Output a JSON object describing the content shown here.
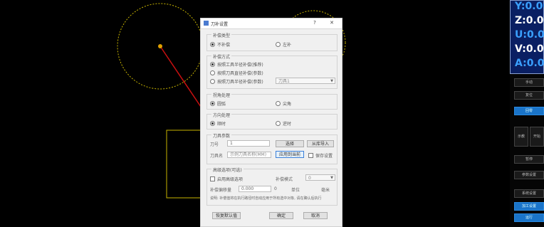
{
  "cad": {
    "circle_color": "#c8b400",
    "line_color": "#c81010",
    "center_color": "#e0a000",
    "rect_color": "#c8b400"
  },
  "dialog": {
    "title": "刀补设置",
    "icon": "app-icon",
    "help_label": "?",
    "close_label": "✕",
    "groups": {
      "g1": {
        "title": "补偿类型",
        "opt_a": "不补偿",
        "opt_b": "左补"
      },
      "g2": {
        "title": "补偿方式",
        "opt_a": "按照工具半径补偿(推荐)",
        "opt_b": "按照刀具直径补偿(参数)",
        "opt_c": "按照刀具半径补偿(参数)",
        "select_value": "刀具1"
      },
      "g3": {
        "title": "拐角处理",
        "opt_a": "圆弧",
        "opt_b": "尖角"
      },
      "g4": {
        "title": "方向处理",
        "opt_a": "顺时",
        "opt_b": "逆时"
      },
      "g5": {
        "title": "刀具参数",
        "row1_label": "刀号",
        "row1_value": "1",
        "btn_a": "选择",
        "btn_b": "从库导入",
        "row2_label": "刀具名",
        "row2_value": "示例刀具名称(MM)",
        "btn_c": "应用到当前",
        "check_label": "保存设置"
      },
      "g6": {
        "title": "高级选项(可选)",
        "check_label": "启用高级选项",
        "sel_label": "补偿模式",
        "sel_value": "0",
        "row2_label": "补偿偏移量",
        "row2_value": "0.000",
        "row2_mid": "0",
        "row2_btn": "单位",
        "row2_tail": "毫米",
        "note": "说明: 补偿值将在执行路径时自动应用于所有选中对象, 请在确认后执行"
      }
    },
    "footer": {
      "btn_default": "恢复默认值",
      "btn_ok": "确定",
      "btn_cancel": "取消"
    }
  },
  "right_panel": {
    "coords": [
      {
        "axis": "Y:",
        "value": "0.00",
        "color": "#3aa0ff"
      },
      {
        "axis": "Z:",
        "value": "0.00",
        "color": "#ffffff"
      },
      {
        "axis": "U:",
        "value": "0.00",
        "color": "#3aa0ff"
      },
      {
        "axis": "V:",
        "value": "0.00",
        "color": "#ffffff"
      },
      {
        "axis": "A:",
        "value": "0.00",
        "color": "#3aa0ff"
      }
    ],
    "buttons": [
      "手动",
      "复位",
      "回零",
      "示教",
      "开始",
      "暂停",
      "参数设置",
      "系统设置",
      "加工设置",
      "运行",
      "停止"
    ]
  }
}
